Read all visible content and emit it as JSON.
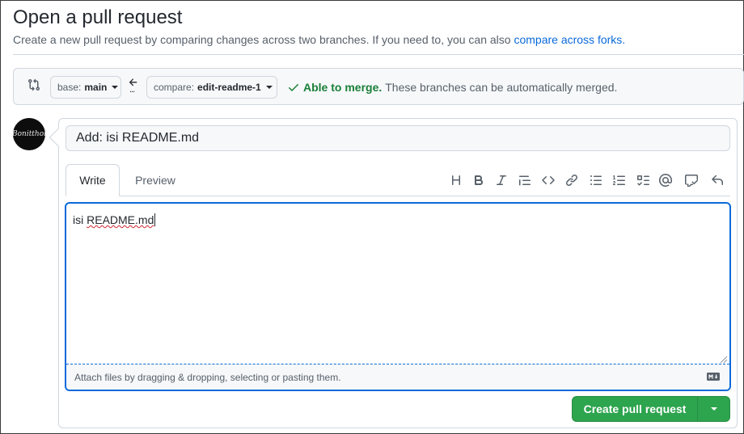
{
  "header": {
    "title": "Open a pull request",
    "subtitle": "Create a new pull request by comparing changes across two branches. If you need to, you can also",
    "subtitle_link": "compare across forks."
  },
  "compare": {
    "base_prefix": "base:",
    "base_branch": "main",
    "compare_prefix": "compare:",
    "compare_branch": "edit-readme-1",
    "merge_status": "Able to merge.",
    "merge_detail": "These branches can be automatically merged.",
    "arrow_dots": "...",
    "status_color": "#1a7f37"
  },
  "avatar": {
    "text": "Bonitthol"
  },
  "pr": {
    "title_value": "Add: isi README.md",
    "tabs": [
      {
        "label": "Write",
        "active": true
      },
      {
        "label": "Preview",
        "active": false
      }
    ],
    "toolbar": [
      "heading-icon",
      "bold-icon",
      "italic-icon",
      "quote-icon",
      "code-icon",
      "link-icon",
      "unordered-list-icon",
      "ordered-list-icon",
      "task-list-icon",
      "mention-icon",
      "reference-icon",
      "undo-icon"
    ],
    "body_prefix": "isi ",
    "body_misspelled": "README.md",
    "attach_text": "Attach files by dragging & dropping, selecting or pasting them.",
    "markdown_icon": "markdown-icon"
  },
  "actions": {
    "create_label": "Create pull request",
    "accent": "#2da44e"
  }
}
